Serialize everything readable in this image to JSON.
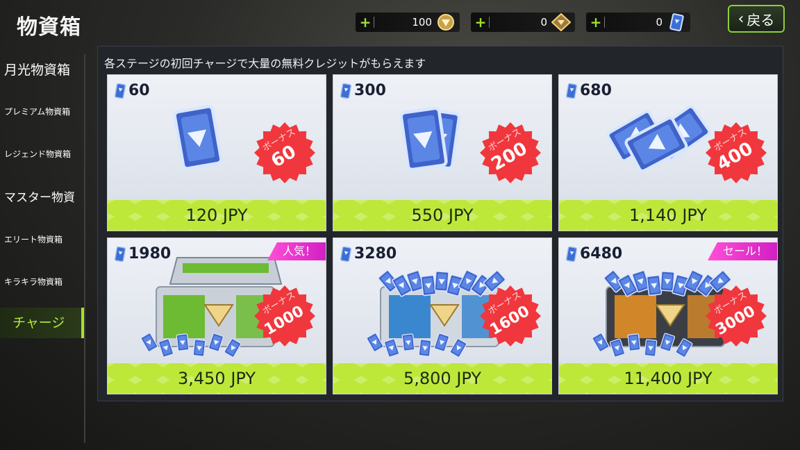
{
  "header": {
    "title": "物資箱",
    "back_label": "戻る"
  },
  "currencies": [
    {
      "name": "gold-coin",
      "value": "100"
    },
    {
      "name": "diamond",
      "value": "0"
    },
    {
      "name": "credit-ticket",
      "value": "0"
    }
  ],
  "sidebar": {
    "items": [
      {
        "label": "月光物資箱"
      },
      {
        "label": "プレミアム物資箱"
      },
      {
        "label": "レジェンド物資箱"
      },
      {
        "label": "マスター物資"
      },
      {
        "label": "エリート物資箱"
      },
      {
        "label": "キラキラ物資箱"
      },
      {
        "label": "チャージ"
      }
    ],
    "active_index": 6
  },
  "notice": "各ステージの初回チャージで大量の無料クレジットがもらえます",
  "bonus_label": "ボーナス",
  "packs": [
    {
      "amount": "60",
      "bonus": "60",
      "price": "120 JPY",
      "tag": ""
    },
    {
      "amount": "300",
      "bonus": "200",
      "price": "550 JPY",
      "tag": ""
    },
    {
      "amount": "680",
      "bonus": "400",
      "price": "1,140 JPY",
      "tag": ""
    },
    {
      "amount": "1980",
      "bonus": "1000",
      "price": "3,450 JPY",
      "tag": "人気！"
    },
    {
      "amount": "3280",
      "bonus": "1600",
      "price": "5,800 JPY",
      "tag": ""
    },
    {
      "amount": "6480",
      "bonus": "3000",
      "price": "11,400 JPY",
      "tag": "セール！"
    }
  ],
  "colors": {
    "accent_green": "#a6e32b",
    "price_bar": "#bde83a",
    "bonus_red": "#f0373d",
    "tag_pink": "#e02bc8"
  }
}
